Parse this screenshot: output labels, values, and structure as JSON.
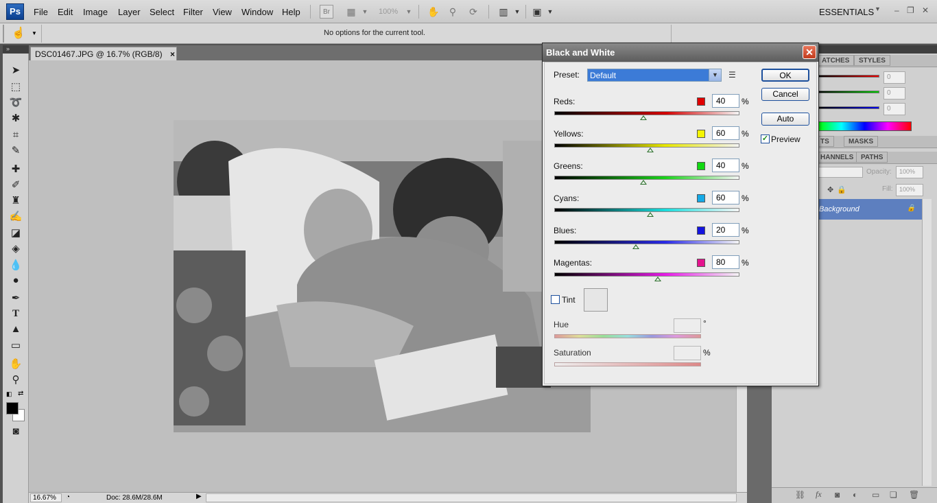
{
  "app": {
    "logo": "Ps",
    "workspace": "ESSENTIALS"
  },
  "menu": [
    "File",
    "Edit",
    "Image",
    "Layer",
    "Select",
    "Filter",
    "View",
    "Window",
    "Help"
  ],
  "menubar_extras": {
    "bridge": "Br",
    "zoom": "100%"
  },
  "options_bar": {
    "message": "No options for the current tool."
  },
  "document": {
    "tab_title": "DSC01467.JPG @ 16.7% (RGB/8)",
    "tab_close": "×"
  },
  "status": {
    "zoom": "16.67%",
    "doc_info": "Doc: 28.6M/28.6M"
  },
  "panels": {
    "tabs_top": [
      "ATCHES",
      "STYLES"
    ],
    "tabs_mid": [
      "TS",
      "MASKS"
    ],
    "tabs_layers": [
      "HANNELS",
      "PATHS"
    ],
    "color_values": [
      "0",
      "0",
      "0"
    ],
    "opacity_label": "Opacity:",
    "opacity_value": "100%",
    "fill_label": "Fill:",
    "fill_value": "100%",
    "layer_name": "Background"
  },
  "dialog": {
    "title": "Black and White",
    "close": "✕",
    "preset_label": "Preset:",
    "preset_value": "Default",
    "buttons": {
      "ok": "OK",
      "cancel": "Cancel",
      "auto": "Auto"
    },
    "preview_label": "Preview",
    "preview_checked": true,
    "sliders": [
      {
        "label": "Reds:",
        "value": "40",
        "unit": "%",
        "color": "#e00000",
        "gradient": "#d10000"
      },
      {
        "label": "Yellows:",
        "value": "60",
        "unit": "%",
        "color": "#f5f500",
        "gradient": "#e6e600"
      },
      {
        "label": "Greens:",
        "value": "40",
        "unit": "%",
        "color": "#11d811",
        "gradient": "#1ad21a"
      },
      {
        "label": "Cyans:",
        "value": "60",
        "unit": "%",
        "color": "#15a9e6",
        "gradient": "#19dcdc"
      },
      {
        "label": "Blues:",
        "value": "20",
        "unit": "%",
        "color": "#1414e0",
        "gradient": "#2a2ae6"
      },
      {
        "label": "Magentas:",
        "value": "80",
        "unit": "%",
        "color": "#e4148e",
        "gradient": "#e61ae6"
      }
    ],
    "tint_label": "Tint",
    "tint_checked": false,
    "hue_label": "Hue",
    "hue_unit": "°",
    "saturation_label": "Saturation",
    "saturation_unit": "%"
  }
}
